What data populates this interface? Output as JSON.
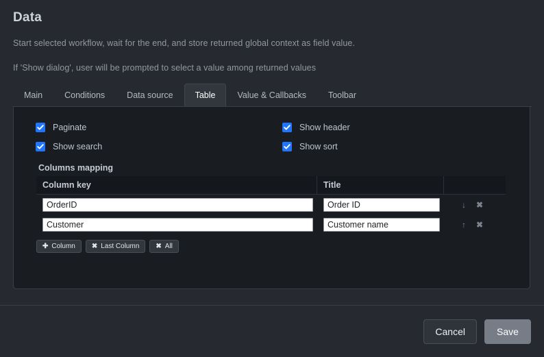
{
  "page": {
    "title": "Data",
    "description_1": "Start selected workflow, wait for the end, and store returned global context as field value.",
    "description_2": "If 'Show dialog', user will be prompted to select a value among returned values"
  },
  "tabs": [
    {
      "label": "Main",
      "active": false
    },
    {
      "label": "Conditions",
      "active": false
    },
    {
      "label": "Data source",
      "active": false
    },
    {
      "label": "Table",
      "active": true
    },
    {
      "label": "Value & Callbacks",
      "active": false
    },
    {
      "label": "Toolbar",
      "active": false
    }
  ],
  "options": {
    "paginate": {
      "label": "Paginate",
      "checked": true
    },
    "show_header": {
      "label": "Show header",
      "checked": true
    },
    "show_search": {
      "label": "Show search",
      "checked": true
    },
    "show_sort": {
      "label": "Show sort",
      "checked": true
    }
  },
  "columns_mapping": {
    "title": "Columns mapping",
    "headers": {
      "key": "Column key",
      "title": "Title",
      "actions": ""
    },
    "rows": [
      {
        "key_value": "OrderID",
        "title_value": "Order ID",
        "move_icon": "arrow-down-icon",
        "move_glyph": "↓",
        "remove_glyph": "✖"
      },
      {
        "key_value": "Customer",
        "title_value": "Customer name",
        "move_icon": "arrow-up-icon",
        "move_glyph": "↑",
        "remove_glyph": "✖"
      }
    ],
    "buttons": [
      {
        "glyph": "✚",
        "label": "Column",
        "name": "add-column-button"
      },
      {
        "glyph": "✖",
        "label": "Last Column",
        "name": "remove-last-column-button"
      },
      {
        "glyph": "✖",
        "label": "All",
        "name": "remove-all-columns-button"
      }
    ]
  },
  "footer": {
    "cancel_label": "Cancel",
    "save_label": "Save"
  },
  "colors": {
    "page_background": "#262a30",
    "panel_background": "#191c21",
    "accent_checkbox": "#2176ff",
    "save_button": "#767d87",
    "border": "#3a3f47"
  }
}
